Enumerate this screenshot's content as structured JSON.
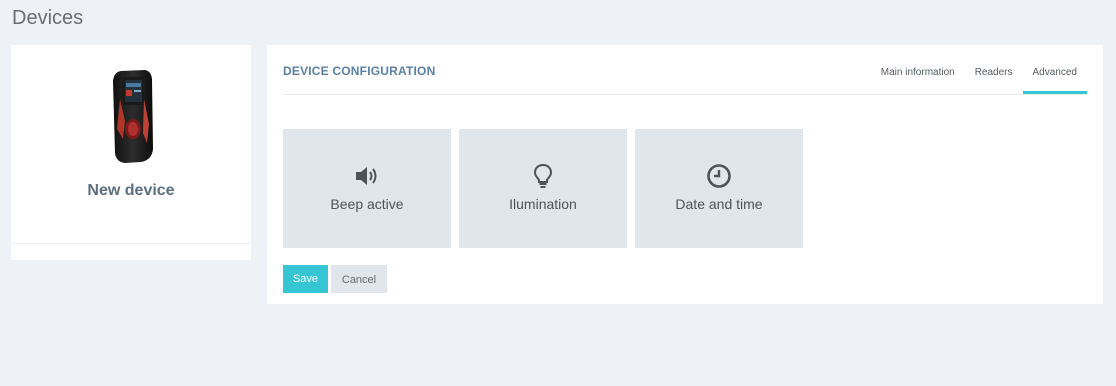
{
  "page": {
    "title": "Devices"
  },
  "device": {
    "name": "New device",
    "image_icon": "fingerprint-terminal-image"
  },
  "config": {
    "title": "DEVICE CONFIGURATION",
    "tabs": [
      {
        "label": "Main information",
        "active": false
      },
      {
        "label": "Readers",
        "active": false
      },
      {
        "label": "Advanced",
        "active": true
      }
    ],
    "tiles": [
      {
        "label": "Beep active",
        "icon": "speaker-icon"
      },
      {
        "label": "Ilumination",
        "icon": "lightbulb-icon"
      },
      {
        "label": "Date and time",
        "icon": "clock-icon"
      }
    ]
  },
  "actions": {
    "save_label": "Save",
    "cancel_label": "Cancel"
  },
  "colors": {
    "accent": "#36c6d3",
    "title_blue": "#5a7fa6",
    "tile_bg": "#e1e5ec",
    "page_bg": "#eef1f5"
  }
}
